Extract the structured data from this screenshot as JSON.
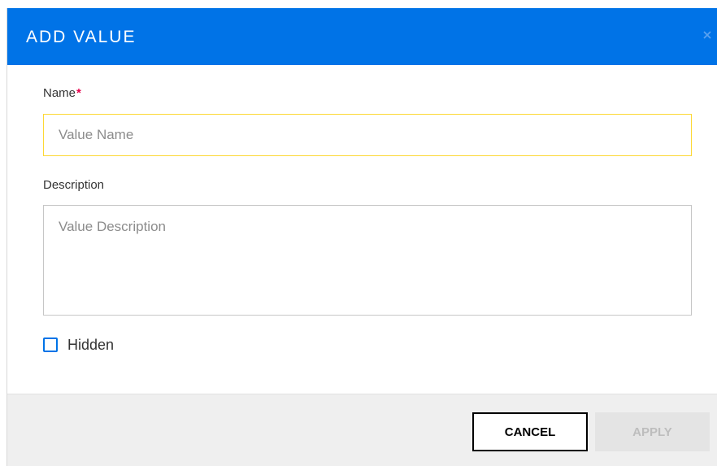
{
  "dialog": {
    "title": "ADD VALUE",
    "close_icon": "close-icon"
  },
  "form": {
    "name": {
      "label": "Name",
      "required_marker": "*",
      "placeholder": "Value Name",
      "value": ""
    },
    "description": {
      "label": "Description",
      "placeholder": "Value Description",
      "value": ""
    },
    "hidden": {
      "label": "Hidden",
      "checked": false
    }
  },
  "footer": {
    "cancel_label": "CANCEL",
    "apply_label": "APPLY",
    "apply_enabled": false
  },
  "colors": {
    "header_bg": "#0073e7",
    "required_star": "#e5004c",
    "focused_border": "#fdd835",
    "footer_bg": "#efefef"
  }
}
